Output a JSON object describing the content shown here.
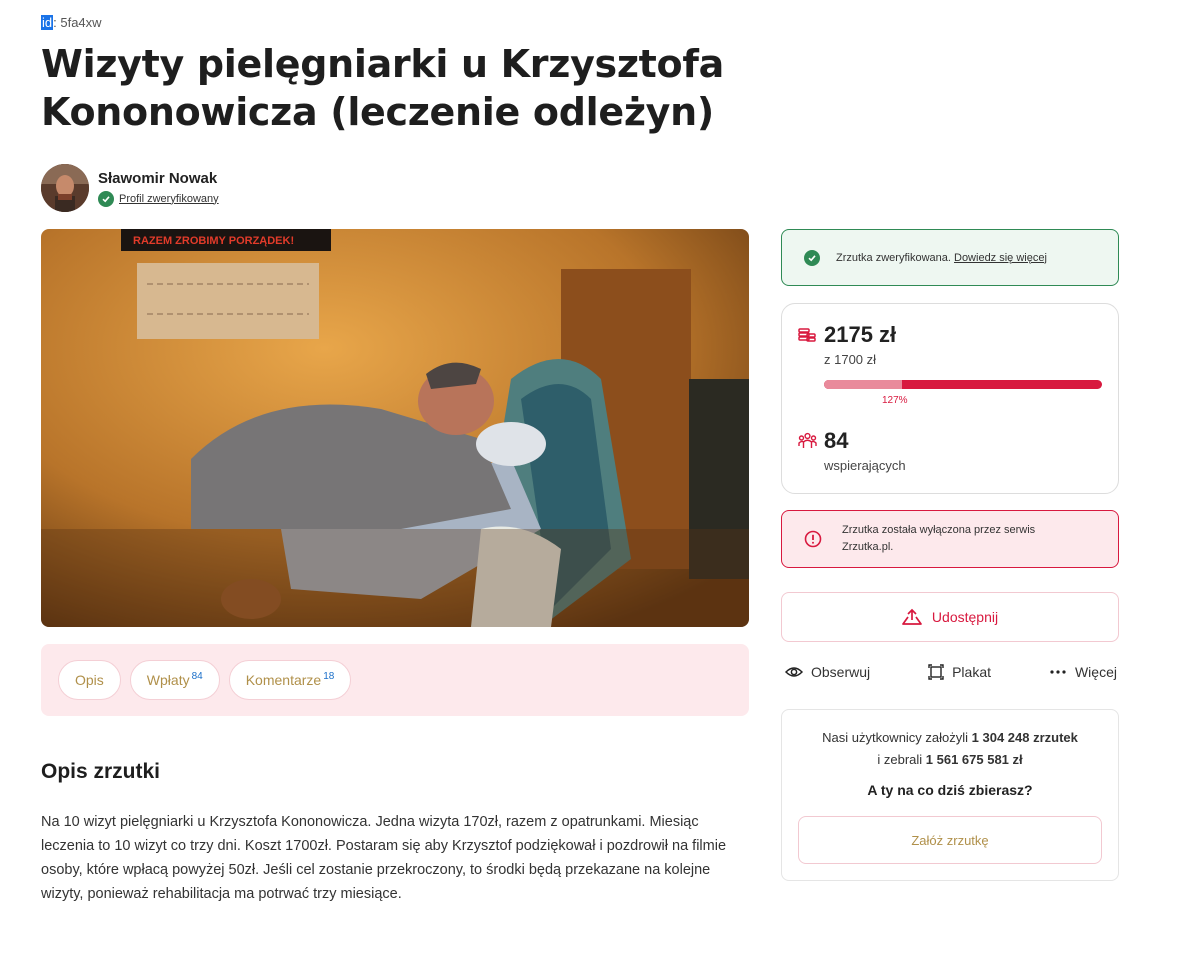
{
  "meta": {
    "id_label": "id",
    "id_value": ": 5fa4xw"
  },
  "title": "Wizyty pielęgniarki u Krzysztofa Kononowicza (leczenie odleżyn)",
  "author": {
    "name": "Sławomir Nowak",
    "verified_label": "Profil zweryfikowany"
  },
  "hero": {
    "banner_text": "RAZEM ZROBIMY PORZĄDEK!"
  },
  "tabs": [
    {
      "label": "Opis",
      "count": ""
    },
    {
      "label": "Wpłaty",
      "count": "84"
    },
    {
      "label": "Komentarze",
      "count": "18"
    }
  ],
  "description": {
    "heading": "Opis zrzutki",
    "text": "Na 10 wizyt pielęgniarki u Krzysztofa Kononowicza. Jedna wizyta 170zł, razem z opatrunkami. Miesiąc leczenia to 10 wizyt co trzy dni. Koszt 1700zł. Postaram się aby Krzysztof podziękował i pozdrowił na filmie osoby, które wpłacą powyżej 50zł. Jeśli cel zostanie przekroczony, to środki będą przekazane na kolejne wizyty, ponieważ rehabilitacja ma potrwać trzy miesiące."
  },
  "sidebar": {
    "verified_text": "Zrzutka zweryfikowana.",
    "verified_link": "Dowiedz się więcej",
    "amount": "2175 zł",
    "goal": "z 1700 zł",
    "percent_label": "127%",
    "progress_fraction": 0.28,
    "backers": "84",
    "backers_label": "wspierających",
    "disabled_line1": "Zrzutka została wyłączona przez serwis",
    "disabled_line2": "Zrzutka.pl.",
    "share_label": "Udostępnij",
    "actions": {
      "observe": "Obserwuj",
      "poster": "Plakat",
      "more": "Więcej"
    },
    "site_stats": {
      "line1_prefix": "Nasi użytkownicy założyli ",
      "line1_bold": "1 304 248 zrzutek",
      "line2_prefix": "i zebrali ",
      "line2_bold": "1 561 675 581 zł",
      "question": "A ty na co dziś zbierasz?",
      "create_label": "Załóż zrzutkę"
    }
  },
  "colors": {
    "accent": "#d8193f",
    "verified": "#2f8a55",
    "tab_bg": "#fde9ec",
    "gold_text": "#b0904a"
  },
  "icons": [
    "check-badge-icon",
    "coins-icon",
    "people-icon",
    "warning-icon",
    "share-icon",
    "eye-icon",
    "poster-icon",
    "more-icon"
  ]
}
